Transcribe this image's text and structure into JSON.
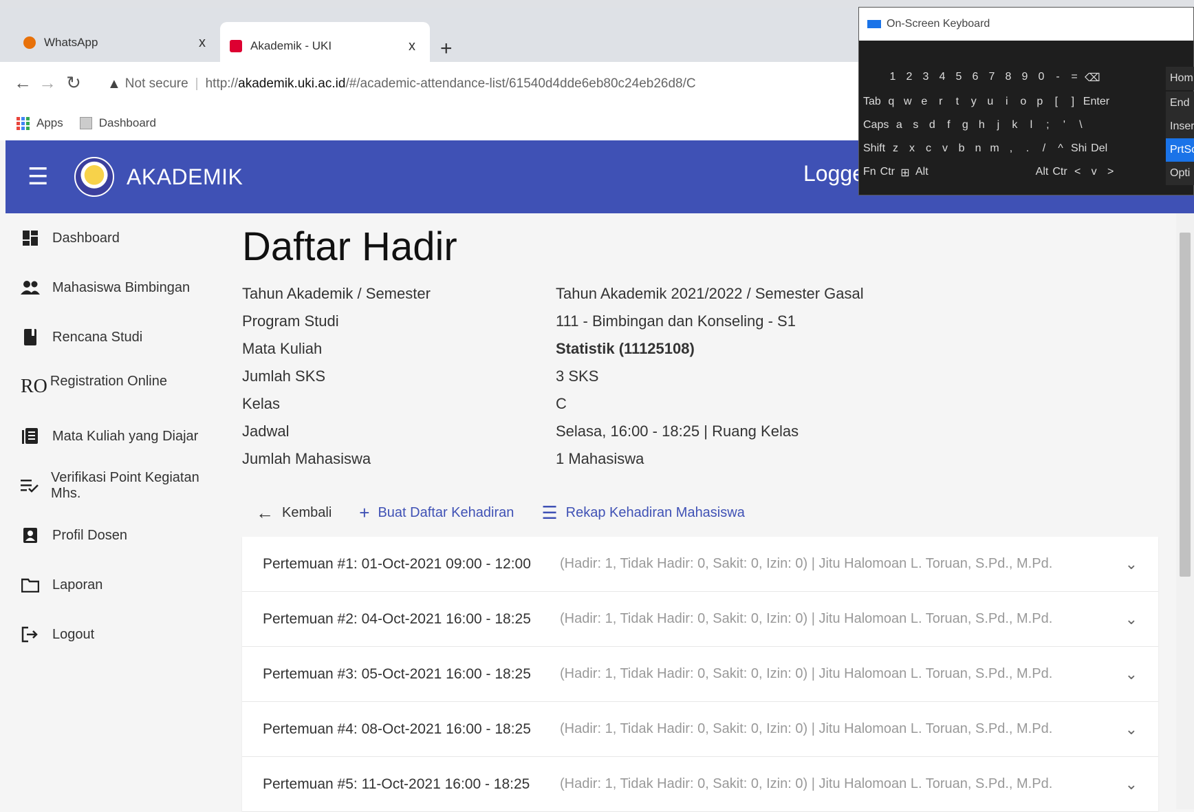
{
  "browser": {
    "tabs": [
      {
        "title": "WhatsApp",
        "active": false
      },
      {
        "title": "Akademik - UKI",
        "active": true
      }
    ],
    "close_glyph": "x",
    "newtab_glyph": "+",
    "security": "Not secure",
    "url_proto": "http://",
    "url_host": "akademik.uki.ac.id",
    "url_path": "/#/academic-attendance-list/61540d4dde6eb80c24eb26d8/C",
    "bookmarks": [
      "Apps",
      "Dashboard"
    ]
  },
  "header": {
    "app_title": "AKADEMIK",
    "logged_text": "Loggec"
  },
  "sidebar": {
    "items": [
      {
        "label": "Dashboard",
        "icon": "dashboard-icon"
      },
      {
        "label": "Mahasiswa Bimbingan",
        "icon": "people-icon"
      },
      {
        "label": "Rencana Studi",
        "icon": "book-icon"
      },
      {
        "label": "Registration Online",
        "prefix": "RO",
        "icon": "ro-icon"
      },
      {
        "label": "Mata Kuliah yang Diajar",
        "icon": "list-book-icon"
      },
      {
        "label": "Verifikasi Point Kegiatan Mhs.",
        "icon": "checklist-icon"
      },
      {
        "label": "Profil Dosen",
        "icon": "profile-icon"
      },
      {
        "label": "Laporan",
        "icon": "folder-icon"
      },
      {
        "label": "Logout",
        "icon": "logout-icon"
      }
    ]
  },
  "main": {
    "title": "Daftar Hadir",
    "info": [
      {
        "label": "Tahun Akademik / Semester",
        "value": "Tahun Akademik 2021/2022 / Semester Gasal"
      },
      {
        "label": "Program Studi",
        "value": "111 - Bimbingan dan Konseling - S1"
      },
      {
        "label": "Mata Kuliah",
        "value": "Statistik (11125108)"
      },
      {
        "label": "Jumlah SKS",
        "value": "3 SKS"
      },
      {
        "label": "Kelas",
        "value": "C"
      },
      {
        "label": "Jadwal",
        "value": "Selasa, 16:00 - 18:25 | Ruang Kelas"
      },
      {
        "label": "Jumlah Mahasiswa",
        "value": "1 Mahasiswa"
      }
    ],
    "actions": {
      "back": "Kembali",
      "create": "Buat Daftar Kehadiran",
      "recap": "Rekap Kehadiran Mahasiswa"
    },
    "meetings": [
      {
        "title": "Pertemuan #1: 01-Oct-2021 09:00 - 12:00",
        "summary": "(Hadir: 1, Tidak Hadir: 0, Sakit: 0, Izin: 0) | Jitu Halomoan L. Toruan, S.Pd., M.Pd."
      },
      {
        "title": "Pertemuan #2: 04-Oct-2021 16:00 - 18:25",
        "summary": "(Hadir: 1, Tidak Hadir: 0, Sakit: 0, Izin: 0) | Jitu Halomoan L. Toruan, S.Pd., M.Pd."
      },
      {
        "title": "Pertemuan #3: 05-Oct-2021 16:00 - 18:25",
        "summary": "(Hadir: 1, Tidak Hadir: 0, Sakit: 0, Izin: 0) | Jitu Halomoan L. Toruan, S.Pd., M.Pd."
      },
      {
        "title": "Pertemuan #4: 08-Oct-2021 16:00 - 18:25",
        "summary": "(Hadir: 1, Tidak Hadir: 0, Sakit: 0, Izin: 0) | Jitu Halomoan L. Toruan, S.Pd., M.Pd."
      },
      {
        "title": "Pertemuan #5: 11-Oct-2021 16:00 - 18:25",
        "summary": "(Hadir: 1, Tidak Hadir: 0, Sakit: 0, Izin: 0) | Jitu Halomoan L. Toruan, S.Pd., M.Pd."
      }
    ]
  },
  "osk": {
    "title": "On-Screen Keyboard",
    "rows": [
      [
        "1",
        "2",
        "3",
        "4",
        "5",
        "6",
        "7",
        "8",
        "9",
        "0",
        "-",
        "="
      ],
      [
        "Tab",
        "q",
        "w",
        "e",
        "r",
        "t",
        "y",
        "u",
        "i",
        "o",
        "p",
        "[",
        "]",
        "Enter"
      ],
      [
        "Caps",
        "a",
        "s",
        "d",
        "f",
        "g",
        "h",
        "j",
        "k",
        "l",
        ";",
        "'",
        "\\"
      ],
      [
        "Shift",
        "z",
        "x",
        "c",
        "v",
        "b",
        "n",
        "m",
        ",",
        ".",
        "/",
        "^",
        "Shi",
        "Del"
      ],
      [
        "Fn",
        "Ctr",
        "Alt",
        "Alt",
        "Ctr",
        "<",
        "v",
        ">"
      ]
    ],
    "side_keys": [
      "Hom",
      "End",
      "Inser",
      "PrtSc",
      "Opti"
    ]
  },
  "colors": {
    "header": "#3f51b5",
    "accent": "#3f51b5"
  }
}
